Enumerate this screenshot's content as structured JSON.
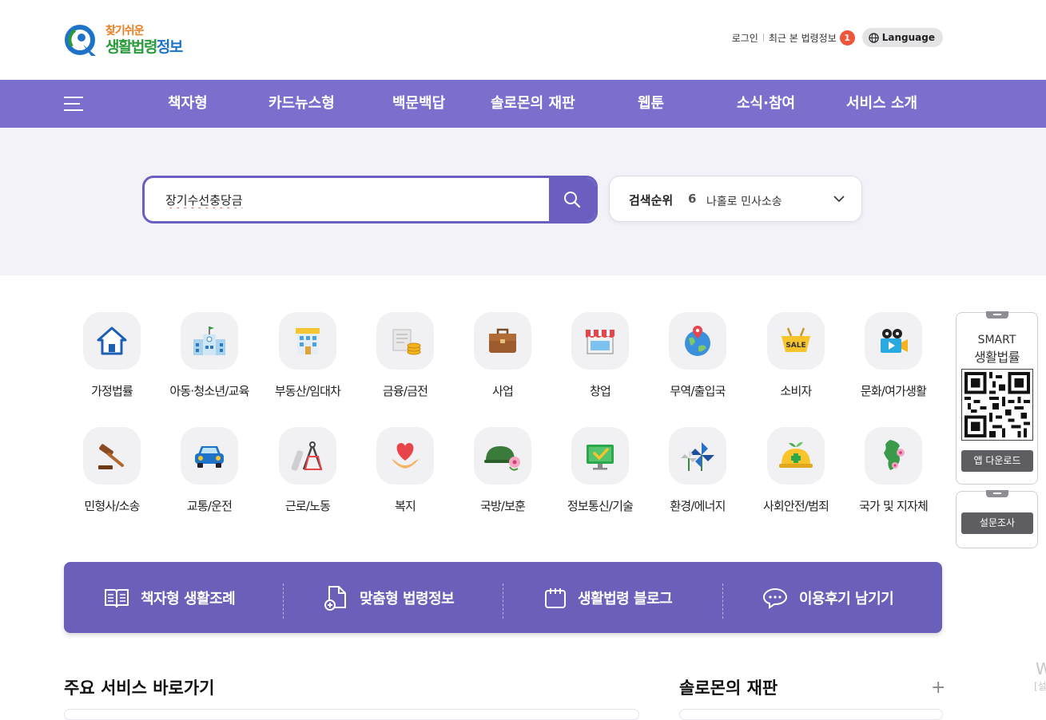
{
  "header": {
    "logo_top": "찾기쉬운",
    "logo_bottom_green": "생활법령",
    "logo_bottom_blue": "정보",
    "login": "로그인",
    "recent": "최근 본 법령정보",
    "recent_count": "1",
    "language": "Language"
  },
  "nav": {
    "items": [
      "책자형",
      "카드뉴스형",
      "백문백답",
      "솔로몬의 재판",
      "웹툰",
      "소식·참여",
      "서비스 소개"
    ]
  },
  "search": {
    "value": "장기수선충당금",
    "rank_label": "검색순위",
    "rank_num": "6",
    "rank_keyword": "나홀로 민사소송"
  },
  "categories": [
    {
      "label": "가정법률",
      "icon": "house-icon"
    },
    {
      "label": "아동·청소년/교육",
      "icon": "school-icon"
    },
    {
      "label": "부동산/임대차",
      "icon": "building-icon"
    },
    {
      "label": "금융/금전",
      "icon": "money-icon"
    },
    {
      "label": "사업",
      "icon": "briefcase-icon"
    },
    {
      "label": "창업",
      "icon": "store-icon"
    },
    {
      "label": "무역/출입국",
      "icon": "globe-icon"
    },
    {
      "label": "소비자",
      "icon": "sale-basket-icon"
    },
    {
      "label": "문화/여가생활",
      "icon": "camera-icon"
    },
    {
      "label": "민형사/소송",
      "icon": "gavel-icon"
    },
    {
      "label": "교통/운전",
      "icon": "car-icon"
    },
    {
      "label": "근로/노동",
      "icon": "drafting-tools-icon"
    },
    {
      "label": "복지",
      "icon": "heart-hands-icon"
    },
    {
      "label": "국방/보훈",
      "icon": "helmet-icon"
    },
    {
      "label": "정보통신/기술",
      "icon": "monitor-icon"
    },
    {
      "label": "환경/에너지",
      "icon": "pinwheel-icon"
    },
    {
      "label": "사회안전/범죄",
      "icon": "safety-helmet-icon"
    },
    {
      "label": "국가 및 지자체",
      "icon": "korea-map-icon"
    }
  ],
  "quick": {
    "items": [
      "책자형 생활조례",
      "맞춤형 법령정보",
      "생활법령 블로그",
      "이용후기 남기기"
    ]
  },
  "sections": {
    "main_services": "주요 서비스 바로가기",
    "solomon": "솔로몬의 재판",
    "plus": "+"
  },
  "side": {
    "smart1": "SMART",
    "smart2": "생활법률",
    "download": "앱 다운로드",
    "survey": "설문조사"
  },
  "watermark": {
    "line1": "W",
    "line2": "[설"
  },
  "colors": {
    "nav": "#7b6fce",
    "quickbar": "#6a5fb9",
    "band": "#f2f2f8",
    "badge": "#f0543a"
  }
}
